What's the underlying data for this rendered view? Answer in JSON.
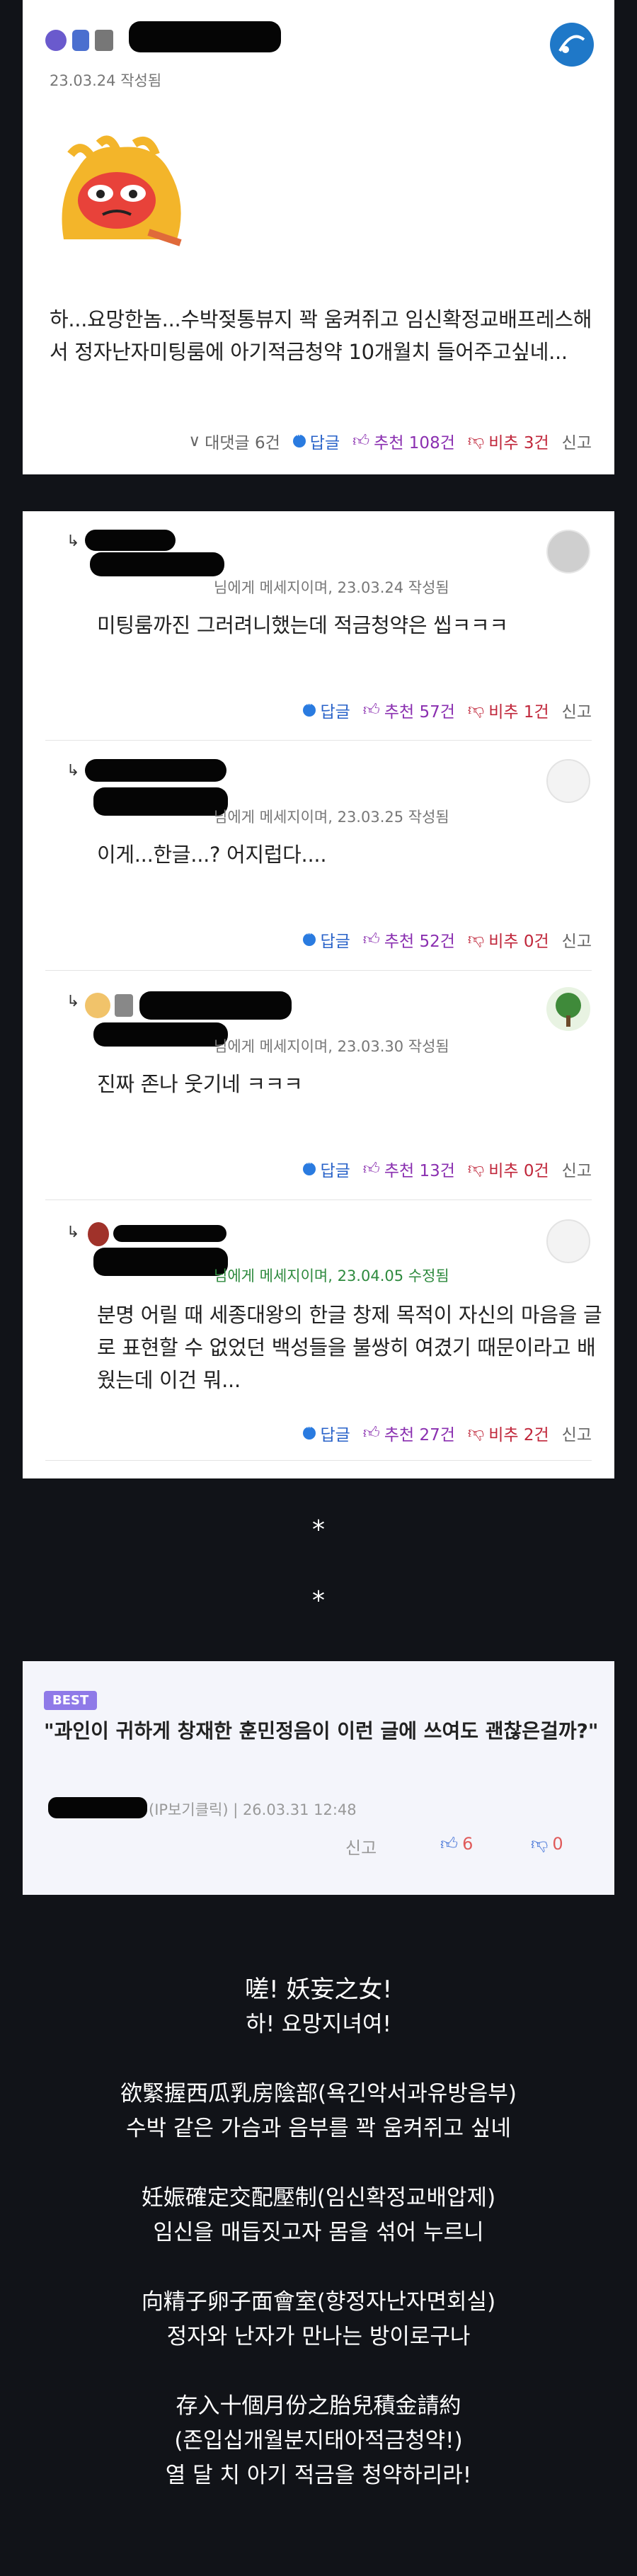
{
  "post": {
    "date": "23.03.24 작성됨",
    "body": "하...요망한놈...수박젖통뷰지 꽉 움켜쥐고 임신확정교배프레스해서 정자난자미팅룸에 아기적금청약 10개월치 들어주고싶네...",
    "replies_toggle": "대댓글 6건",
    "reply": "답글",
    "upvote": "추천 108건",
    "downvote": "비추 3건",
    "report": "신고"
  },
  "comments": [
    {
      "meta": "님에게 메세지이며, 23.03.24 작성됨",
      "text": "미팅룸까진 그러려니했는데 적금청약은 씹ㅋㅋㅋ",
      "reply": "답글",
      "upvote": "추천 57건",
      "downvote": "비추 1건",
      "report": "신고"
    },
    {
      "meta": "님에게 메세지이며, 23.03.25 작성됨",
      "text": "이게...한글...? 어지럽다....",
      "reply": "답글",
      "upvote": "추천 52건",
      "downvote": "비추 0건",
      "report": "신고"
    },
    {
      "meta": "님에게 메세지이며, 23.03.30 작성됨",
      "text": "진짜 존나 웃기네 ㅋㅋㅋ",
      "reply": "답글",
      "upvote": "추천 13건",
      "downvote": "비추 0건",
      "report": "신고"
    },
    {
      "meta": "님에게 메세지이며, 23.04.05 수정됨",
      "text": "분명 어릴 때 세종대왕의 한글 창제 목적이 자신의 마음을 글로 표현할 수 없었던 백성들을 불쌍히 여겼기 때문이라고 배웠는데 이건 뭐...",
      "reply": "답글",
      "upvote": "추천 27건",
      "downvote": "비추 2건",
      "report": "신고"
    }
  ],
  "separators": [
    "*",
    "*"
  ],
  "best": {
    "badge": "BEST",
    "quote": "\"과인이 귀하게 창재한 훈민정음이 이런 글에 쓰여도 괜찮은걸까?\"",
    "meta": "(IP보기클릭) | 26.03.31 12:48",
    "report": "신고",
    "up": "6",
    "down": "0",
    "colors": {
      "badge": "#8f7ae8",
      "up": "#4a78d8",
      "down": "#e05a5a"
    }
  },
  "poem": [
    "嗟! 妖妄之女!",
    "하! 요망지녀여!",
    "",
    "欲緊握西瓜乳房陰部(욕긴악서과유방음부)",
    "수박 같은 가슴과 음부를 꽉 움켜쥐고 싶네",
    "",
    "妊娠確定交配壓制(임신확정교배압제)",
    "임신을 매듭짓고자 몸을 섞어 누르니",
    "",
    "向精子卵子面會室(향정자난자면회실)",
    "정자와 난자가 만나는 방이로구나",
    "",
    "存入十個月份之胎兒積金請約",
    "(존입십개월분지태아적금청약!)",
    "열 달 치 아기 적금을 청약하리라!"
  ]
}
